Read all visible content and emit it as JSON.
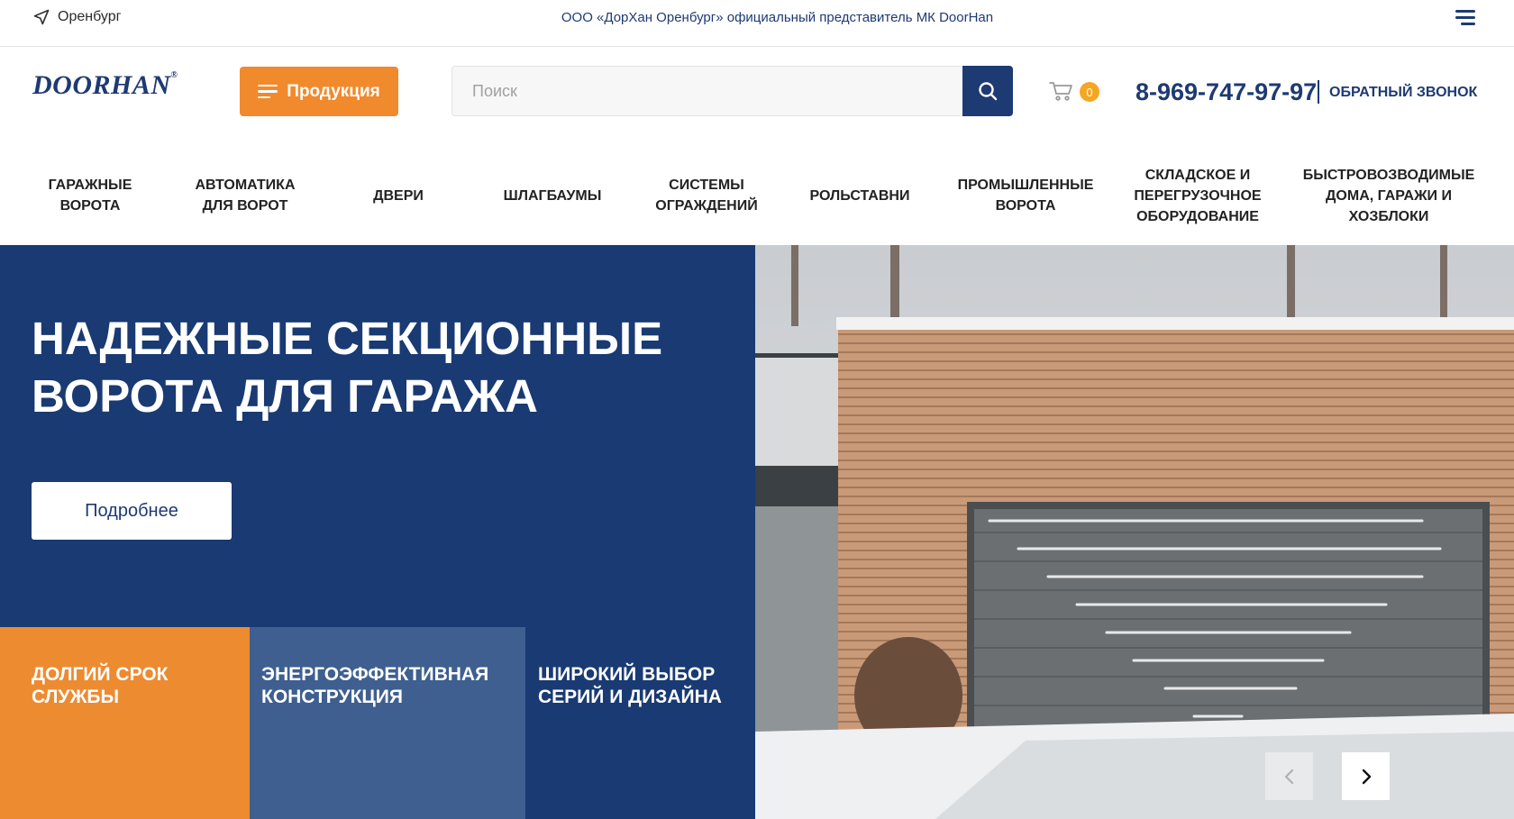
{
  "topbar": {
    "city": "Оренбург",
    "tagline": "ООО «ДорХан Оренбург» официальный представитель МК DoorHan"
  },
  "header": {
    "logo_text": "DoorHan",
    "products_button": "Продукция",
    "search_placeholder": "Поиск",
    "cart_count": "0",
    "phone": "8-969-747-97-97",
    "callback": "ОБРАТНЫЙ ЗВОНОК"
  },
  "nav": {
    "items": [
      "ГАРАЖНЫЕ ВОРОТА",
      "АВТОМАТИКА ДЛЯ ВОРОТ",
      "ДВЕРИ",
      "ШЛАГБАУМЫ",
      "СИСТЕМЫ ОГРАЖДЕНИЙ",
      "РОЛЬСТАВНИ",
      "ПРОМЫШЛЕННЫЕ ВОРОТА",
      "СКЛАДСКОЕ И ПЕРЕГРУЗОЧНОЕ ОБОРУДОВАНИЕ",
      "БЫСТРОВОЗВОДИМЫЕ ДОМА, ГАРАЖИ И ХОЗБЛОКИ"
    ]
  },
  "hero": {
    "title": "НАДЕЖНЫЕ СЕКЦИОННЫЕ ВОРОТА ДЛЯ ГАРАЖА",
    "button": "Подробнее",
    "features": [
      "ДОЛГИЙ СРОК СЛУЖБЫ",
      "ЭНЕРГОЭФФЕКТИВНАЯ КОНСТРУКЦИЯ",
      "ШИРОКИЙ ВЫБОР СЕРИЙ И ДИЗАЙНА"
    ]
  },
  "colors": {
    "brand_blue": "#1e3a73",
    "accent_orange": "#f18a2c",
    "feature_mid_blue": "#3e5f8f"
  },
  "icons": {
    "city": "location-arrow-icon",
    "menu": "hamburger-menu-icon",
    "search": "search-icon",
    "cart": "cart-icon",
    "prev": "chevron-left-icon",
    "next": "chevron-right-icon"
  }
}
